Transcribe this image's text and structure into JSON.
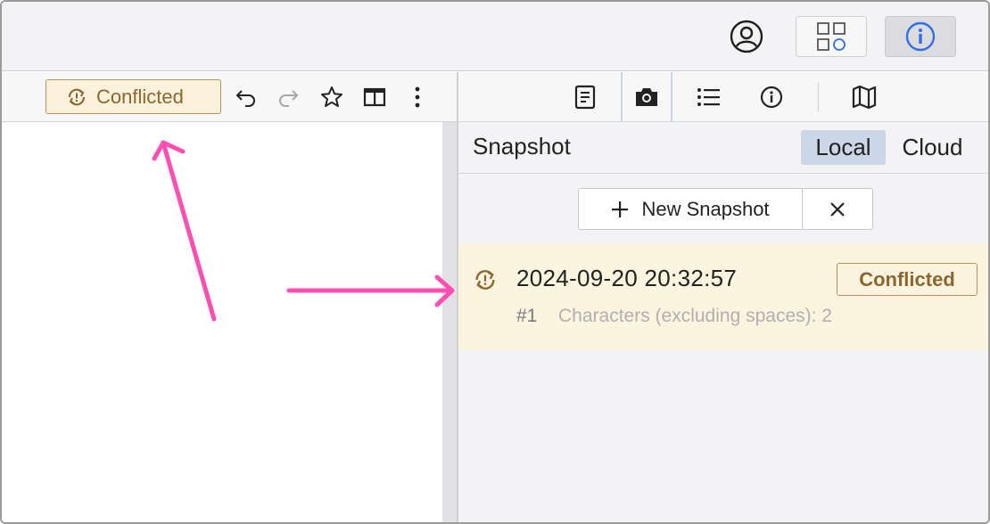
{
  "topbar": {
    "account_icon": "user-circle-icon",
    "apps_icon": "apps-grid-icon",
    "info_icon": "info-icon"
  },
  "editor_toolbar": {
    "conflict_badge": {
      "label": "Conflicted",
      "icon": "sync-alert-icon"
    },
    "tools": [
      "undo-icon",
      "redo-icon",
      "star-icon",
      "split-view-icon",
      "more-vertical-icon"
    ]
  },
  "right_toolbar": {
    "tools": [
      "document-icon",
      "camera-icon",
      "list-icon",
      "info-icon",
      "map-icon"
    ],
    "active": "camera-icon"
  },
  "snapshot_panel": {
    "title": "Snapshot",
    "tabs": [
      {
        "label": "Local",
        "selected": true
      },
      {
        "label": "Cloud",
        "selected": false
      }
    ],
    "new_button": "New Snapshot",
    "items": [
      {
        "timestamp": "2024-09-20 20:32:57",
        "number": "#1",
        "meta": "Characters (excluding spaces): 2",
        "status": "Conflicted"
      }
    ]
  },
  "colors": {
    "accent_conflict": "#b8925a",
    "conflict_text": "#8a6630",
    "conflict_bg": "#fcf2db",
    "selected_tab": "#cbd6e6",
    "annotation": "#ff4fb3",
    "info_icon_blue": "#2f6fe0"
  }
}
